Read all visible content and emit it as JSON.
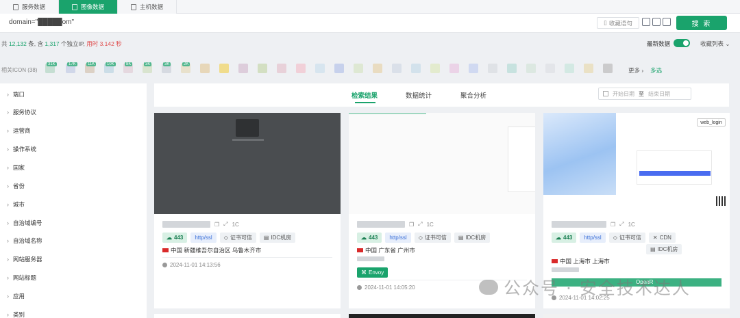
{
  "tabs": [
    {
      "label": "服务数据",
      "icon": "list-icon"
    },
    {
      "label": "图像数据",
      "icon": "image-icon"
    },
    {
      "label": "主机数据",
      "icon": "host-icon"
    }
  ],
  "search": {
    "query": "domain=\"█████om\"",
    "save_label": "收藏语句",
    "button_label": "搜 索"
  },
  "stats": {
    "prefix": "共",
    "total": "12,132",
    "unit1": "条, 含",
    "ip_count": "1,317",
    "unit2": "个独立IP,",
    "elapsed_label": "用时 3.142 秒"
  },
  "controls": {
    "latest_label": "最新数据",
    "latest_on": true,
    "fav_list_label": "收藏列表"
  },
  "icon_row": {
    "label": "相关ICON (38)",
    "badges": [
      "31K",
      "17K",
      "11K",
      "10K",
      "8K",
      "3K",
      "3K",
      "2K"
    ],
    "more_label": "更多",
    "multi_label": "多选"
  },
  "filters": [
    "端口",
    "服务协议",
    "运营商",
    "操作系统",
    "国家",
    "省份",
    "城市",
    "自治域编号",
    "自治域名称",
    "网站服务器",
    "网站标题",
    "应用",
    "类别"
  ],
  "result_tabs": [
    "检索结果",
    "数据统计",
    "聚合分析"
  ],
  "date_range": {
    "start": "开始日期",
    "sep": "至",
    "end": "结束日期"
  },
  "cards": [
    {
      "port": "443",
      "proto": "http/ssl",
      "cert": "证书可信",
      "extra": [
        "IDC机房"
      ],
      "ip_suffix": "1C",
      "location": "中国 新疆维吾尔自治区 乌鲁木齐市",
      "time": "2024-11-01 14:13:56",
      "app_tags": []
    },
    {
      "port": "443",
      "proto": "http/ssl",
      "cert": "证书可信",
      "extra": [
        "IDC机房"
      ],
      "ip_suffix": "1C",
      "location": "中国 广东省 广州市",
      "time": "2024-11-01 14:05:20",
      "app_tags": [
        "Envoy"
      ]
    },
    {
      "port": "443",
      "proto": "http/ssl",
      "cert": "证书可信",
      "extra": [
        "CDN",
        "IDC机房"
      ],
      "ip_suffix": "1C",
      "location": "中国 上海市 上海市",
      "time": "2024-11-01 14:02:25",
      "app_tags": [
        "OpenR"
      ],
      "login_badge": "web_login"
    }
  ],
  "watermark": "公众号 · 安全技术达人",
  "colors": {
    "accent": "#1aa36c",
    "danger": "#e04b4b"
  }
}
